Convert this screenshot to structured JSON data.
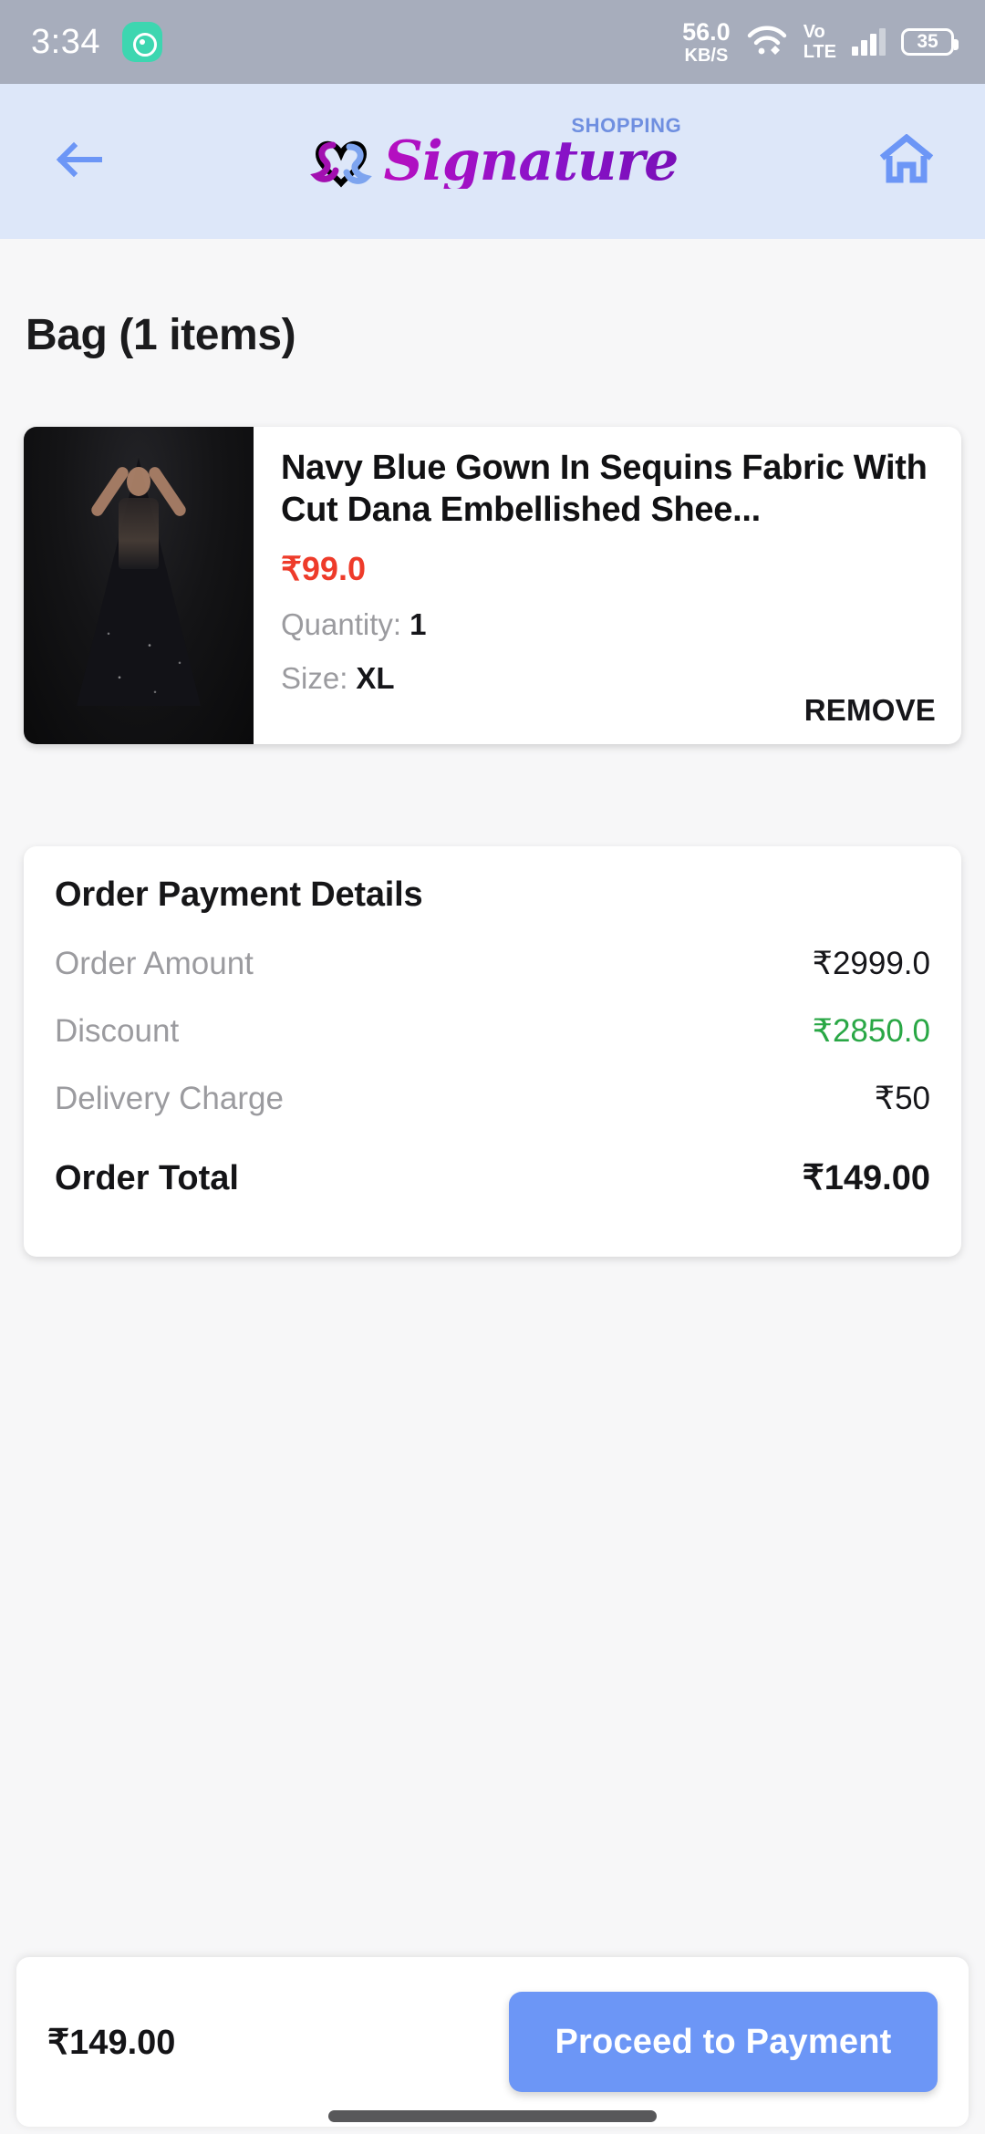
{
  "status_bar": {
    "time": "3:34",
    "app_icon": "music-notification-icon",
    "network_speed_value": "56.0",
    "network_speed_unit": "KB/S",
    "wifi_icon": "wifi-icon",
    "volte_line1": "Vo",
    "volte_line2": "LTE",
    "signal_icon": "signal-bars-icon",
    "battery_level": "35"
  },
  "app_bar": {
    "back_icon": "arrow-left-icon",
    "home_icon": "home-icon",
    "brand_name": "Signature",
    "brand_suffix": "SHOPPING",
    "brand_mark": "heart-monogram-icon",
    "brand_color": "#8a12c9",
    "brand_suffix_color": "#6f8fe0",
    "bar_background": "#dde7f9"
  },
  "page": {
    "title": "Bag (1 items)"
  },
  "cart_items": [
    {
      "image": "navy-blue-sequin-gown-photo",
      "title": "Navy Blue Gown In Sequins Fabric With Cut Dana Embellished Shee...",
      "price": "₹99.0",
      "price_color": "#ee3b2a",
      "quantity_label": "Quantity:",
      "quantity_value": "1",
      "size_label": "Size:",
      "size_value": "XL",
      "remove_label": "REMOVE"
    }
  ],
  "payment_details": {
    "heading": "Order Payment Details",
    "rows": [
      {
        "label": "Order Amount",
        "value": "₹2999.0",
        "color": "#16161a"
      },
      {
        "label": "Discount",
        "value": "₹2850.0",
        "color": "#29a745"
      },
      {
        "label": "Delivery Charge",
        "value": "₹50",
        "color": "#16161a"
      }
    ],
    "total_label": "Order Total",
    "total_value": "₹149.00"
  },
  "bottom_bar": {
    "total": "₹149.00",
    "cta_label": "Proceed to Payment",
    "cta_color": "#6c96f6"
  }
}
